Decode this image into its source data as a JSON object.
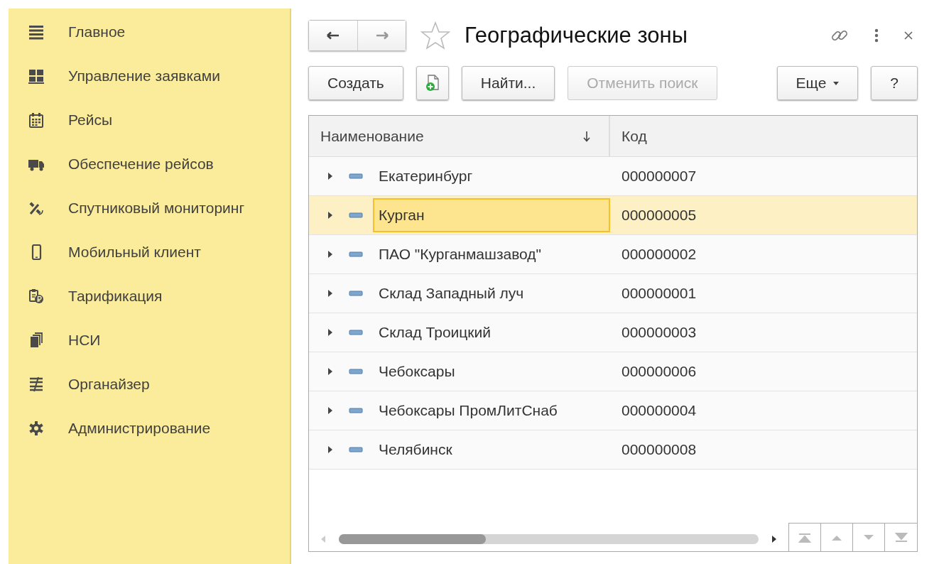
{
  "sidebar": {
    "items": [
      {
        "label": "Главное"
      },
      {
        "label": "Управление заявками"
      },
      {
        "label": "Рейсы"
      },
      {
        "label": "Обеспечение рейсов"
      },
      {
        "label": "Спутниковый мониторинг"
      },
      {
        "label": "Мобильный клиент"
      },
      {
        "label": "Тарификация"
      },
      {
        "label": "НСИ"
      },
      {
        "label": "Органайзер"
      },
      {
        "label": "Администрирование"
      }
    ]
  },
  "window": {
    "title": "Географические зоны",
    "favorite": false
  },
  "toolbar": {
    "buttons": [
      {
        "kind": "text",
        "label": "Создать",
        "disabled": false
      },
      {
        "kind": "add-copy",
        "disabled": false
      },
      {
        "kind": "text",
        "label": "Найти...",
        "disabled": false
      },
      {
        "kind": "text",
        "label": "Отменить поиск",
        "disabled": true
      },
      {
        "kind": "menu",
        "label": "Еще",
        "disabled": false
      },
      {
        "kind": "text",
        "label": "?",
        "disabled": false
      }
    ]
  },
  "table": {
    "columns": [
      {
        "label": "Наименование",
        "sorted": true
      },
      {
        "label": "Код",
        "sorted": false
      }
    ],
    "rows": [
      {
        "name": "Екатеринбург",
        "code": "000000007",
        "selected": false
      },
      {
        "name": "Курган",
        "code": "000000005",
        "selected": true
      },
      {
        "name": "ПАО \"Курганмашзавод\"",
        "code": "000000002",
        "selected": false
      },
      {
        "name": "Склад Западный луч",
        "code": "000000001",
        "selected": false
      },
      {
        "name": "Склад Троицкий",
        "code": "000000003",
        "selected": false
      },
      {
        "name": "Чебоксары",
        "code": "000000006",
        "selected": false
      },
      {
        "name": "Чебоксары ПромЛитСнаб",
        "code": "000000004",
        "selected": false
      },
      {
        "name": "Челябинск",
        "code": "000000008",
        "selected": false
      }
    ]
  }
}
